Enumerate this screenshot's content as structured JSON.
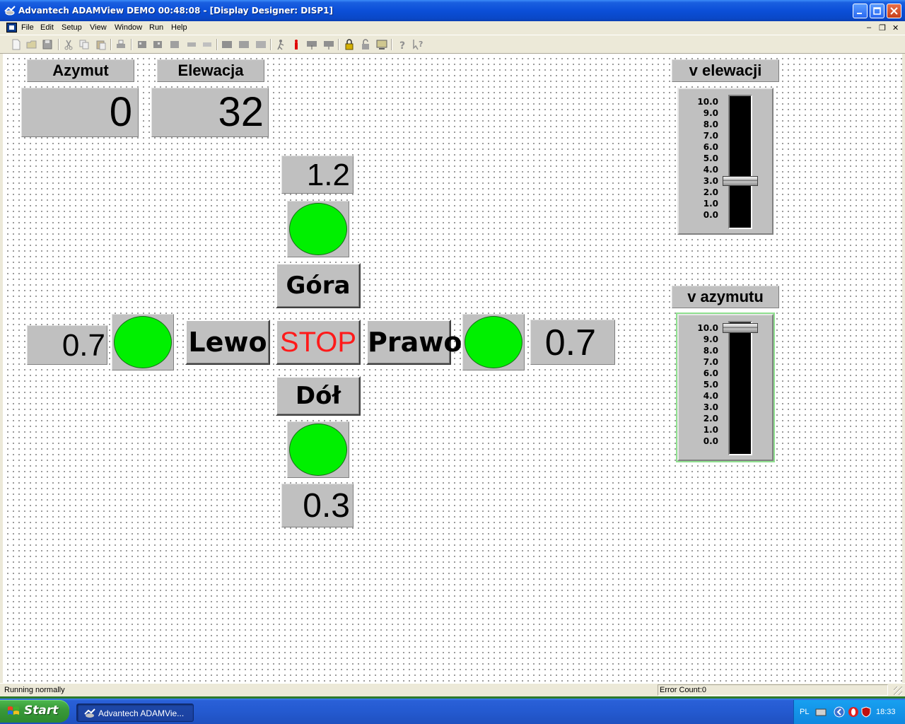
{
  "window": {
    "title": "Advantech ADAMView DEMO 00:48:08 - [Display Designer: DISP1]"
  },
  "menu": {
    "items": [
      "File",
      "Edit",
      "Setup",
      "View",
      "Window",
      "Run",
      "Help"
    ]
  },
  "canvas": {
    "labels": {
      "azymut": "Azymut",
      "elewacja": "Elewacja",
      "v_elewacji": "v elewacji",
      "v_azymutu": "v azymutu"
    },
    "displays": {
      "azymut_value": "0",
      "elewacja_value": "32",
      "top_speed": "1.2",
      "left_speed": "0.7",
      "right_speed": "0.7",
      "bottom_speed": "0.3"
    },
    "buttons": {
      "gora": "Góra",
      "lewo": "Lewo",
      "stop": "STOP",
      "prawo": "Prawo",
      "dol": "Dół"
    },
    "lamp_color": "#00f000",
    "stop_color": "#ff1a1a",
    "sliders": {
      "v_elewacji": {
        "ticks": [
          "10.0",
          "9.0",
          "8.0",
          "7.0",
          "6.0",
          "5.0",
          "4.0",
          "3.0",
          "2.0",
          "1.0",
          "0.0"
        ],
        "value": 3.0,
        "min": 0,
        "max": 10
      },
      "v_azymutu": {
        "ticks": [
          "10.0",
          "9.0",
          "8.0",
          "7.0",
          "6.0",
          "5.0",
          "4.0",
          "3.0",
          "2.0",
          "1.0",
          "0.0"
        ],
        "value": 10.0,
        "min": 0,
        "max": 10
      }
    }
  },
  "statusbar": {
    "left": "Running normally",
    "right": "Error Count:0"
  },
  "taskbar": {
    "start_label": "Start",
    "task_label": "Advantech ADAMVie...",
    "language": "PL",
    "clock": "18:33"
  }
}
